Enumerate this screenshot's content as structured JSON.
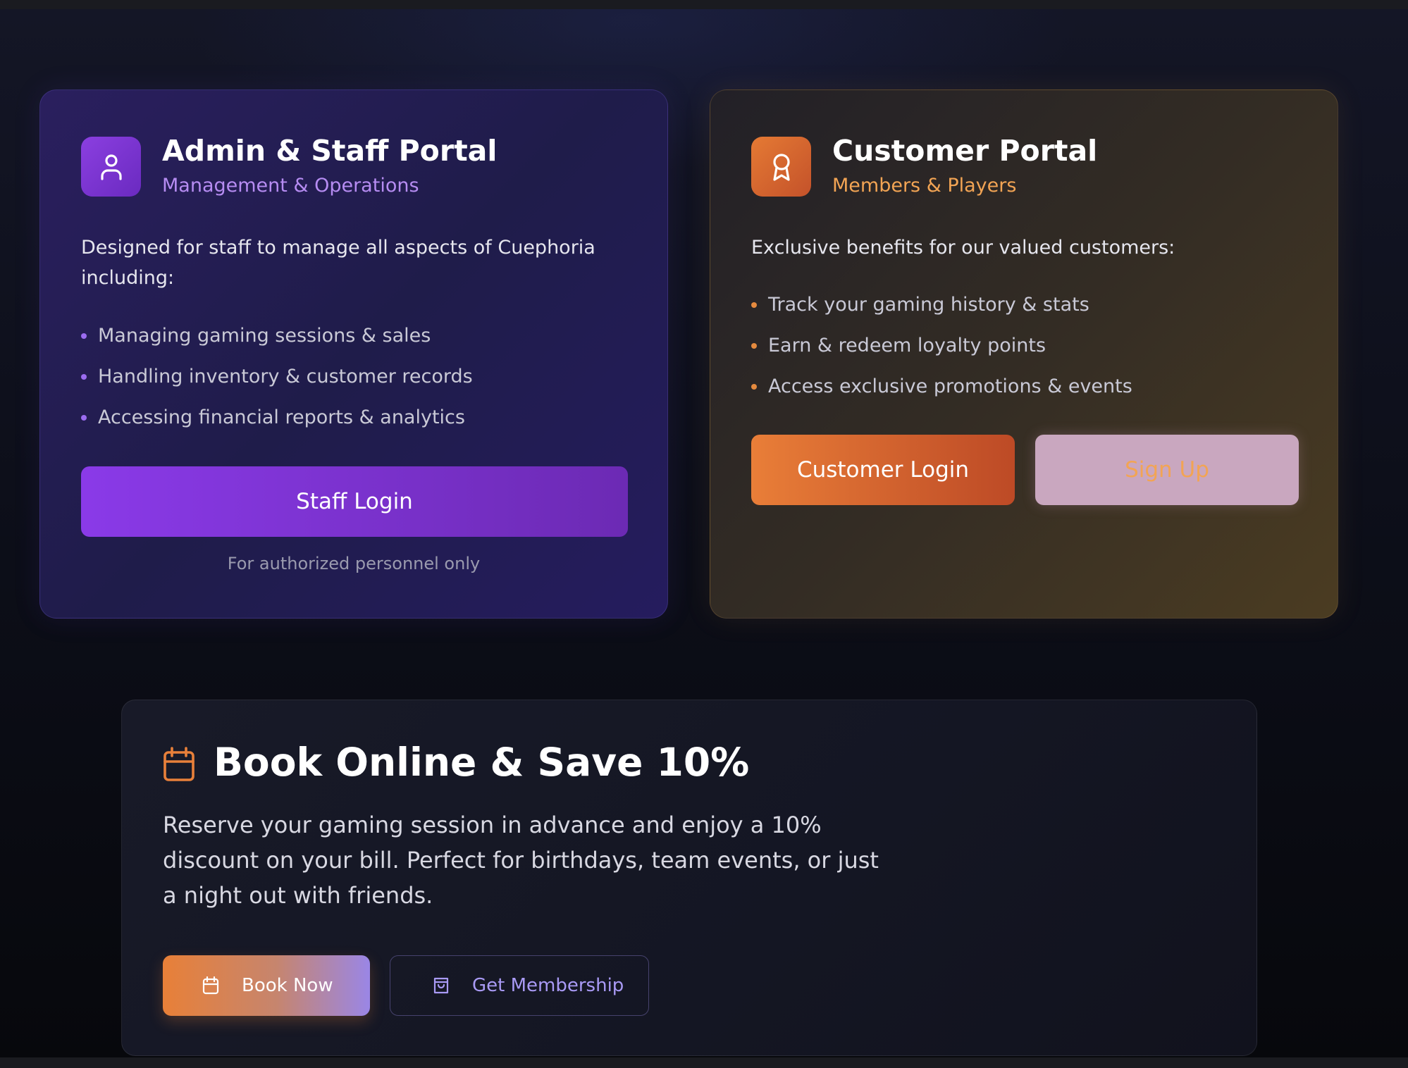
{
  "admin_card": {
    "title": "Admin & Staff Portal",
    "subtitle": "Management & Operations",
    "icon": "user-icon",
    "description": "Designed for staff to manage all aspects of Cuephoria including:",
    "bullets": [
      "Managing gaming sessions & sales",
      "Handling inventory & customer records",
      "Accessing financial reports & analytics"
    ],
    "login_label": "Staff Login",
    "note": "For authorized personnel only",
    "accent_color": "#8b3fe0"
  },
  "customer_card": {
    "title": "Customer Portal",
    "subtitle": "Members & Players",
    "icon": "award-icon",
    "description": "Exclusive benefits for our valued customers:",
    "bullets": [
      "Track your gaming history & stats",
      "Earn & redeem loyalty points",
      "Access exclusive promotions & events"
    ],
    "login_label": "Customer Login",
    "signup_label": "Sign Up",
    "accent_color": "#e57a34"
  },
  "booking": {
    "icon": "calendar-icon",
    "title": "Book Online & Save 10%",
    "description": "Reserve your gaming session in advance and enjoy a 10% discount on your bill. Perfect for birthdays, team events, or just a night out with friends.",
    "book_label": "Book Now",
    "book_icon": "calendar-icon",
    "membership_label": "Get Membership",
    "membership_icon": "shopping-bag-icon"
  }
}
